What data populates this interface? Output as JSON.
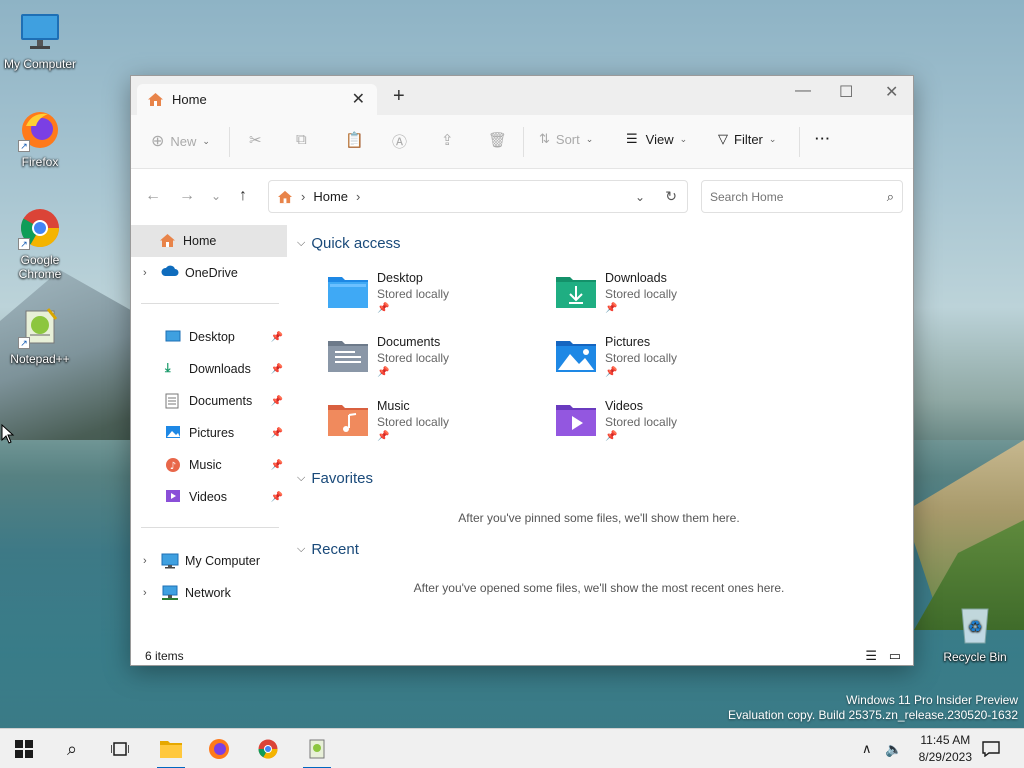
{
  "desktop": {
    "icons": [
      {
        "label": "My Computer"
      },
      {
        "label": "Firefox"
      },
      {
        "label": "Google Chrome"
      },
      {
        "label": "Notepad++"
      },
      {
        "label": "Recycle Bin"
      }
    ]
  },
  "window": {
    "tab": {
      "title": "Home"
    },
    "toolbar": {
      "new_label": "New",
      "sort_label": "Sort",
      "view_label": "View",
      "filter_label": "Filter",
      "more_label": "···"
    },
    "address": {
      "segment": "Home"
    },
    "search": {
      "placeholder": "Search Home"
    },
    "nav": {
      "home": "Home",
      "onedrive": "OneDrive",
      "pinned": [
        "Desktop",
        "Downloads",
        "Documents",
        "Pictures",
        "Music",
        "Videos"
      ],
      "my_computer": "My Computer",
      "network": "Network"
    },
    "sections": {
      "quick_access": "Quick access",
      "favorites": "Favorites",
      "recent": "Recent"
    },
    "quick_access_items": [
      {
        "name": "Desktop",
        "sub": "Stored locally"
      },
      {
        "name": "Downloads",
        "sub": "Stored locally"
      },
      {
        "name": "Documents",
        "sub": "Stored locally"
      },
      {
        "name": "Pictures",
        "sub": "Stored locally"
      },
      {
        "name": "Music",
        "sub": "Stored locally"
      },
      {
        "name": "Videos",
        "sub": "Stored locally"
      }
    ],
    "favorites_empty": "After you've pinned some files, we'll show them here.",
    "recent_empty": "After you've opened some files, we'll show the most recent ones here.",
    "status": "6 items"
  },
  "watermark": {
    "line1": "Windows 11 Pro Insider Preview",
    "line2": "Evaluation copy. Build 25375.zn_release.230520-1632"
  },
  "taskbar": {
    "time": "11:45 AM",
    "date": "8/29/2023"
  }
}
